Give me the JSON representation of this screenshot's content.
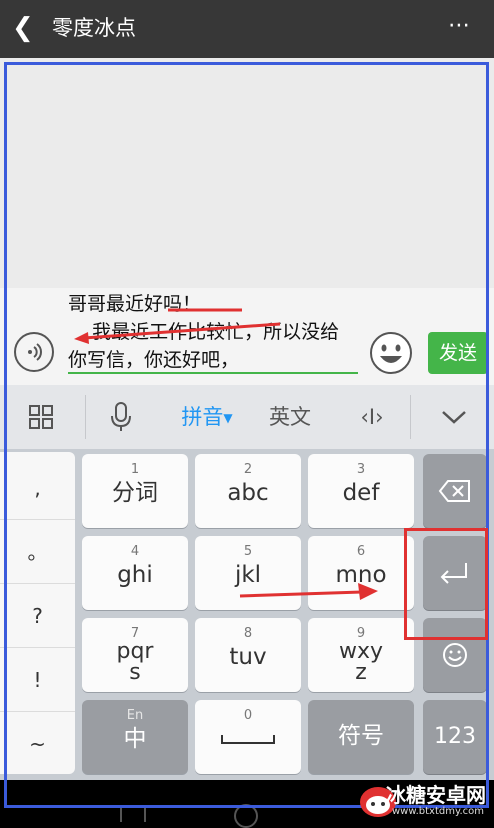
{
  "titlebar": {
    "back_glyph": "❮",
    "title": "零度冰点",
    "more_glyph": "⋯"
  },
  "input": {
    "value": "哥哥最近好吗！\n    我最近工作比较忙，所以没给你写信，你还好吧，",
    "send_label": "发送"
  },
  "ime_toolbar": {
    "mode_pinyin": "拼音",
    "mode_english": "英文",
    "cursor_glyph": "‹I›",
    "accent": "#2196f3"
  },
  "punctuation": [
    ",",
    "。",
    "?",
    "!",
    "~"
  ],
  "keys": {
    "row1": [
      {
        "num": "1",
        "label": "分词"
      },
      {
        "num": "2",
        "label": "abc"
      },
      {
        "num": "3",
        "label": "def"
      }
    ],
    "row2": [
      {
        "num": "4",
        "label": "ghi"
      },
      {
        "num": "5",
        "label": "jkl"
      },
      {
        "num": "6",
        "label": "mno"
      }
    ],
    "row3": [
      {
        "num": "7",
        "label": "pqr",
        "label2": "s"
      },
      {
        "num": "8",
        "label": "tuv"
      },
      {
        "num": "9",
        "label": "wxy",
        "label2": "z"
      }
    ],
    "row4": [
      {
        "num": "En",
        "label": "中"
      },
      {
        "num": "0",
        "label": ""
      },
      {
        "num": "",
        "label": "符号"
      }
    ],
    "fn_123": "123"
  },
  "watermark": {
    "text": "冰糖安卓网",
    "url": "www.btxtdmy.com"
  },
  "colors": {
    "send_green": "#44b549",
    "annotation_red": "#e03131",
    "annotation_blue": "#3b5bdb"
  }
}
